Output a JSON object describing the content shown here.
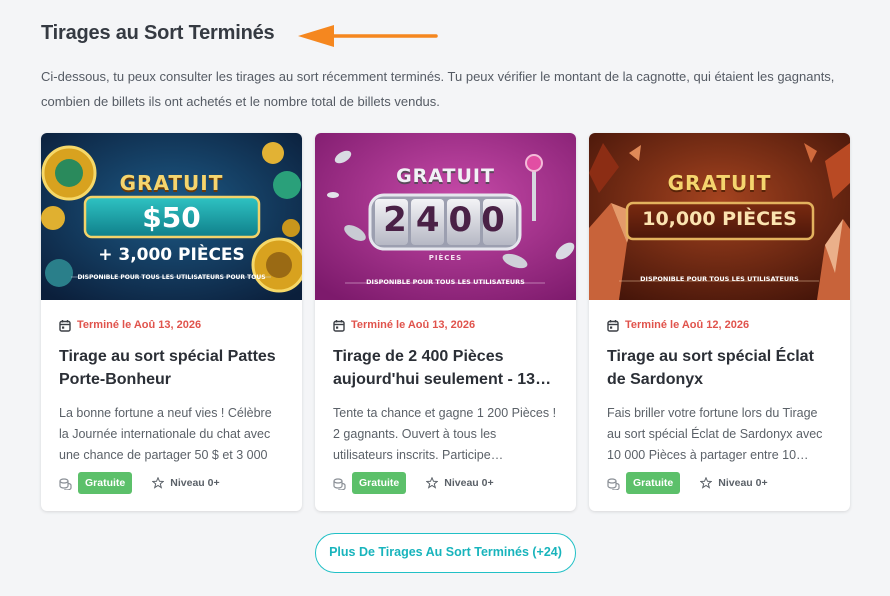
{
  "page": {
    "title": "Tirages au Sort Terminés",
    "intro": "Ci-dessous, tu peux consulter les tirages au sort récemment terminés. Tu peux vérifier le montant de la cagnotte, qui étaient les gagnants, combien de billets ils ont achetés et le nombre total de billets vendus."
  },
  "colors": {
    "accent_teal": "#21c0c6",
    "date_red": "#e0534c",
    "badge_green": "#5cc06a",
    "arrow_orange": "#f5871f"
  },
  "cards": [
    {
      "banner": {
        "free": "GRATUIT",
        "amount": "$50",
        "extra": "+ 3,000 PIÈCES",
        "footer": "DISPONIBLE POUR TOUS LES UTILISATEURS POUR TOUS"
      },
      "date": "Terminé le Aoû 13, 2026",
      "title": "Tirage au sort spécial Pattes Porte-Bonheur",
      "description": "La bonne fortune a neuf vies ! Célèbre la Journée internationale du chat avec une chance de partager 50 $ et 3 000 pièc…",
      "badge": "Gratuite",
      "level": "Niveau 0+"
    },
    {
      "banner": {
        "free": "GRATUIT",
        "amount": "2400",
        "sub": "PIÈCES",
        "footer": "DISPONIBLE POUR TOUS LES UTILISATEURS"
      },
      "date": "Terminé le Aoû 13, 2026",
      "title": "Tirage de 2 400 Pièces aujourd'hui seulement - 13…",
      "description": "Tente ta chance et gagne 1 200 Pièces ! 2 gagnants. Ouvert à tous les utilisateurs inscrits. Participe…",
      "badge": "Gratuite",
      "level": "Niveau 0+"
    },
    {
      "banner": {
        "free": "GRATUIT",
        "amount": "10,000 PIÈCES",
        "footer": "DISPONIBLE POUR TOUS LES UTILISATEURS"
      },
      "date": "Terminé le Aoû 12, 2026",
      "title": "Tirage au sort spécial Éclat de Sardonyx",
      "description": "Fais briller votre fortune lors du Tirage au sort spécial Éclat de Sardonyx avec 10 000 Pièces à partager entre 10…",
      "badge": "Gratuite",
      "level": "Niveau 0+"
    }
  ],
  "more_button": "Plus De Tirages Au Sort Terminés (+24)"
}
